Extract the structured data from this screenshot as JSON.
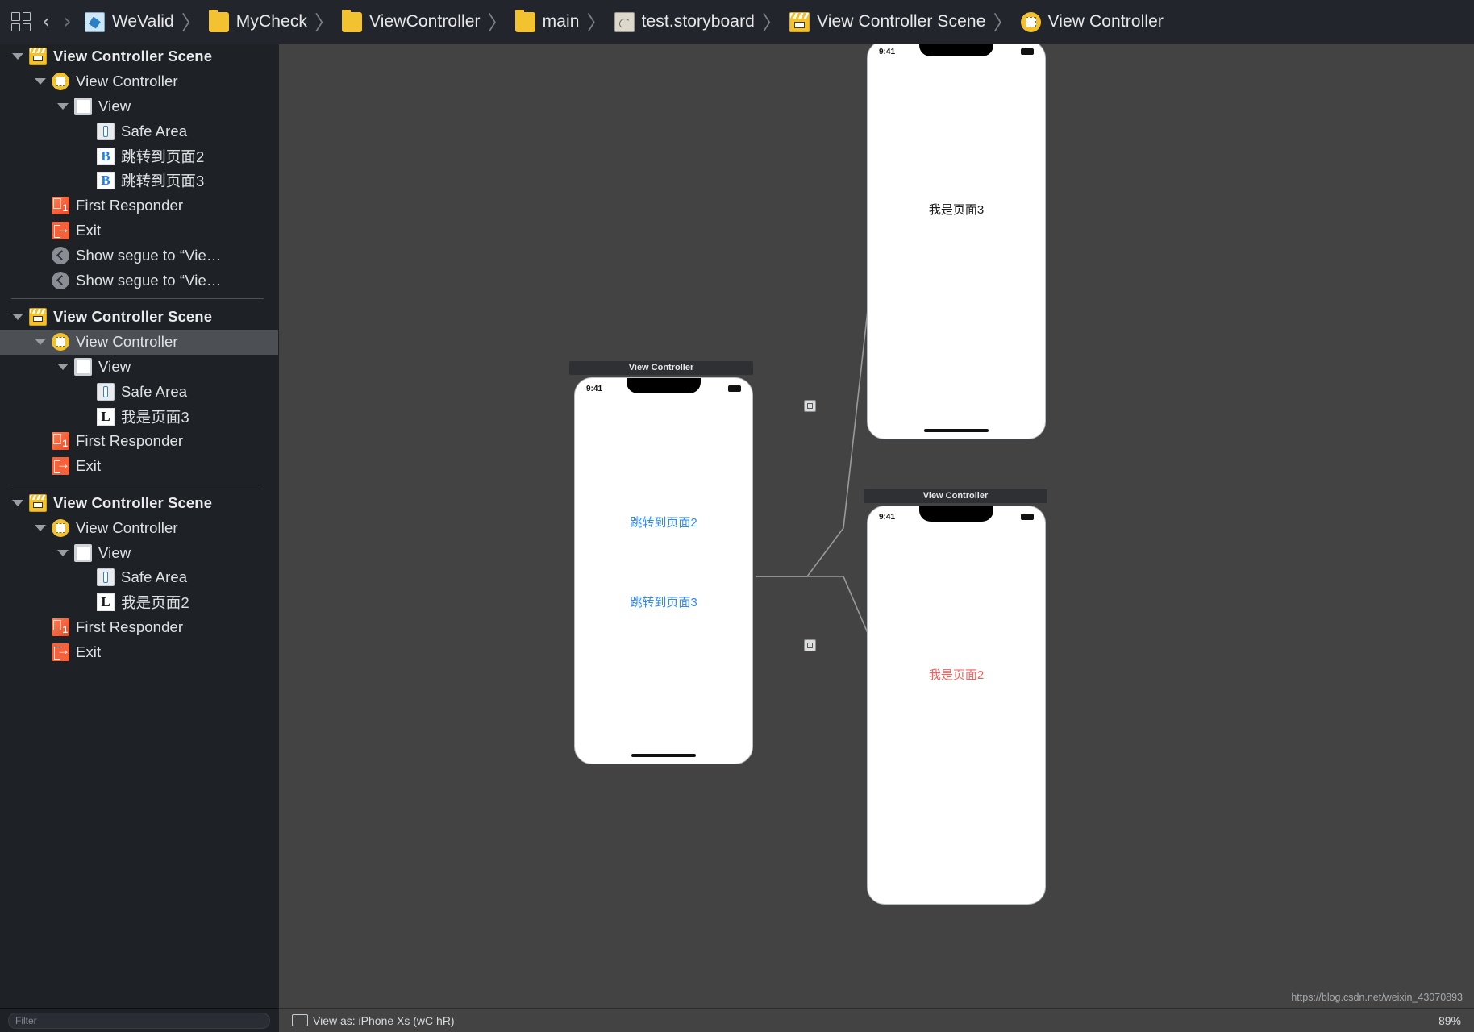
{
  "breadcrumb": {
    "jump_bar_icon": "grid-icon",
    "back_label": "‹",
    "forward_label": "›",
    "items": [
      {
        "label": "WeValid",
        "icon": "swift-project-icon"
      },
      {
        "label": "MyCheck",
        "icon": "folder-icon"
      },
      {
        "label": "ViewController",
        "icon": "folder-icon"
      },
      {
        "label": "main",
        "icon": "folder-icon"
      },
      {
        "label": "test.storyboard",
        "icon": "storyboard-file-icon"
      },
      {
        "label": "View Controller Scene",
        "icon": "scene-icon"
      },
      {
        "label": "View Controller",
        "icon": "view-controller-icon"
      }
    ],
    "separator": "〉"
  },
  "outline": {
    "rows": [
      {
        "label": "View Controller Scene",
        "icon": "scene-icon",
        "indent": 0,
        "twisty": true,
        "bold": true,
        "selected": false
      },
      {
        "label": "View Controller",
        "icon": "view-controller-icon",
        "indent": 1,
        "twisty": true,
        "bold": false,
        "selected": false
      },
      {
        "label": "View",
        "icon": "view-icon",
        "indent": 2,
        "twisty": true,
        "bold": false,
        "selected": false
      },
      {
        "label": "Safe Area",
        "icon": "safe-area-icon",
        "indent": 3,
        "twisty": false,
        "bold": false,
        "selected": false
      },
      {
        "label": "跳转到页面2",
        "icon": "button-icon",
        "glyph": "B",
        "indent": 3,
        "twisty": false,
        "bold": false,
        "selected": false
      },
      {
        "label": "跳转到页面3",
        "icon": "button-icon",
        "glyph": "B",
        "indent": 3,
        "twisty": false,
        "bold": false,
        "selected": false
      },
      {
        "label": "First Responder",
        "icon": "first-responder-icon",
        "glyph": "1",
        "indent": 1,
        "twisty": false,
        "bold": false,
        "selected": false
      },
      {
        "label": "Exit",
        "icon": "exit-icon",
        "indent": 1,
        "twisty": false,
        "bold": false,
        "selected": false
      },
      {
        "label": "Show segue to “Vie…",
        "icon": "segue-icon",
        "indent": 1,
        "twisty": false,
        "bold": false,
        "selected": false
      },
      {
        "label": "Show segue to “Vie…",
        "icon": "segue-icon",
        "indent": 1,
        "twisty": false,
        "bold": false,
        "selected": false
      },
      {
        "divider": true
      },
      {
        "label": "View Controller Scene",
        "icon": "scene-icon",
        "indent": 0,
        "twisty": true,
        "bold": true,
        "selected": false
      },
      {
        "label": "View Controller",
        "icon": "view-controller-icon",
        "indent": 1,
        "twisty": true,
        "bold": false,
        "selected": true
      },
      {
        "label": "View",
        "icon": "view-icon",
        "indent": 2,
        "twisty": true,
        "bold": false,
        "selected": false
      },
      {
        "label": "Safe Area",
        "icon": "safe-area-icon",
        "indent": 3,
        "twisty": false,
        "bold": false,
        "selected": false
      },
      {
        "label": "我是页面3",
        "icon": "label-icon",
        "glyph": "L",
        "indent": 3,
        "twisty": false,
        "bold": false,
        "selected": false
      },
      {
        "label": "First Responder",
        "icon": "first-responder-icon",
        "glyph": "1",
        "indent": 1,
        "twisty": false,
        "bold": false,
        "selected": false
      },
      {
        "label": "Exit",
        "icon": "exit-icon",
        "indent": 1,
        "twisty": false,
        "bold": false,
        "selected": false
      },
      {
        "divider": true
      },
      {
        "label": "View Controller Scene",
        "icon": "scene-icon",
        "indent": 0,
        "twisty": true,
        "bold": true,
        "selected": false
      },
      {
        "label": "View Controller",
        "icon": "view-controller-icon",
        "indent": 1,
        "twisty": true,
        "bold": false,
        "selected": false
      },
      {
        "label": "View",
        "icon": "view-icon",
        "indent": 2,
        "twisty": true,
        "bold": false,
        "selected": false
      },
      {
        "label": "Safe Area",
        "icon": "safe-area-icon",
        "indent": 3,
        "twisty": false,
        "bold": false,
        "selected": false
      },
      {
        "label": "我是页面2",
        "icon": "label-icon",
        "glyph": "L",
        "indent": 3,
        "twisty": false,
        "bold": false,
        "selected": false
      },
      {
        "label": "First Responder",
        "icon": "first-responder-icon",
        "glyph": "1",
        "indent": 1,
        "twisty": false,
        "bold": false,
        "selected": false
      },
      {
        "label": "Exit",
        "icon": "exit-icon",
        "indent": 1,
        "twisty": false,
        "bold": false,
        "selected": false
      }
    ],
    "filter_placeholder": "Filter"
  },
  "canvas": {
    "scenes": [
      {
        "name": "main-view-controller",
        "title": "View Controller",
        "status_time": "9:41",
        "texts": [
          {
            "text": "跳转到页面2",
            "color_class": "blue"
          },
          {
            "text": "跳转到页面3",
            "color_class": "blue"
          }
        ]
      },
      {
        "name": "page3-view-controller",
        "title": "View Controller",
        "status_time": "9:41",
        "texts": [
          {
            "text": "我是页面3",
            "color_class": "black"
          }
        ]
      },
      {
        "name": "page2-view-controller",
        "title": "View Controller",
        "status_time": "9:41",
        "texts": [
          {
            "text": "我是页面2",
            "color_class": "red"
          }
        ]
      }
    ],
    "device_name": "View as: iPhone Xs (wC hR)",
    "zoom_level": "89%"
  },
  "watermark": "https://blog.csdn.net/weixin_43070893",
  "colors": {
    "accent_blue": "#2f8bf4",
    "label_red": "#f4615c",
    "scene_yellow": "#f3c02e",
    "sidebar_bg": "#1e2126",
    "canvas_bg": "#434343",
    "selection": "#4c4f54"
  }
}
